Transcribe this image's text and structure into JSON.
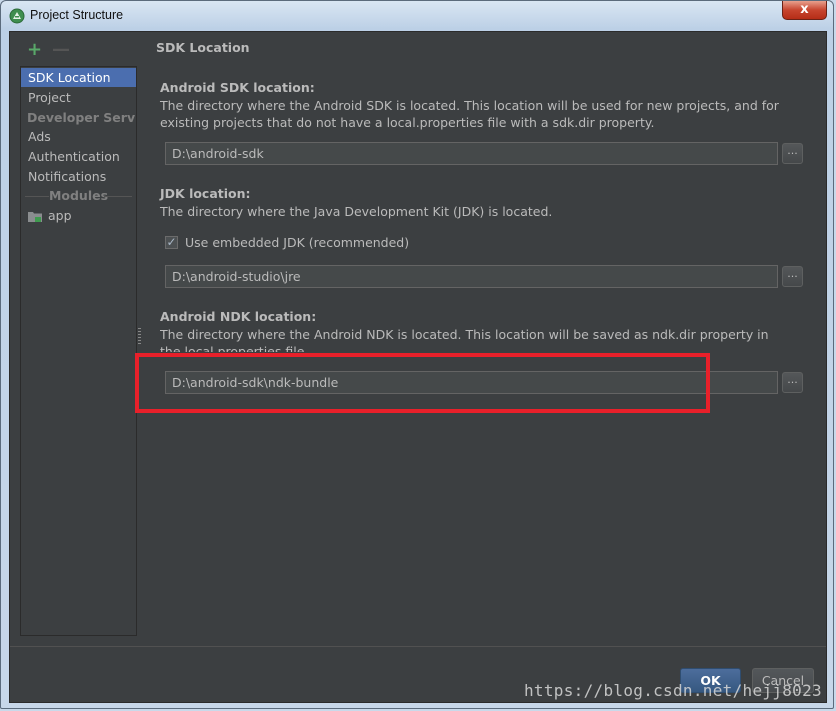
{
  "window": {
    "title": "Project Structure",
    "close_glyph": "x",
    "icon": "android-studio-icon"
  },
  "toolbar": {
    "add_glyph": "+",
    "remove_glyph": "—"
  },
  "sidebar": {
    "items": [
      {
        "label": "SDK Location",
        "selected": true
      },
      {
        "label": "Project"
      },
      {
        "label": "Developer Servi..."
      },
      {
        "label": "Ads"
      },
      {
        "label": "Authentication"
      },
      {
        "label": "Notifications"
      }
    ],
    "modules_header": "Modules",
    "modules": [
      {
        "label": "app",
        "icon": "module-folder-icon"
      }
    ]
  },
  "main": {
    "page_title": "SDK Location",
    "android_sdk": {
      "title": "Android SDK location:",
      "description": "The directory where the Android SDK is located. This location will be used for new projects, and for existing projects that do not have a local.properties file with a sdk.dir property.",
      "path": "D:\\android-sdk",
      "browse_label": "..."
    },
    "jdk": {
      "title": "JDK location:",
      "description": "The directory where the Java Development Kit (JDK) is located.",
      "checkbox_label": "Use embedded JDK (recommended)",
      "checkbox_checked": true,
      "checkbox_glyph": "✓",
      "path": "D:\\android-studio\\jre",
      "browse_label": "..."
    },
    "android_ndk": {
      "title": "Android NDK location:",
      "description": "The directory where the Android NDK is located. This location will be saved as ndk.dir property in the local.properties file.",
      "path": "D:\\android-sdk\\ndk-bundle",
      "browse_label": "..."
    }
  },
  "footer": {
    "ok_label": "OK",
    "cancel_label": "Cancel"
  },
  "watermark": "https://blog.csdn.net/hejj8023",
  "colors": {
    "background": "#3c3f41",
    "selection": "#4b6eaf",
    "highlight": "#e8202a",
    "add_green": "#59a869"
  }
}
